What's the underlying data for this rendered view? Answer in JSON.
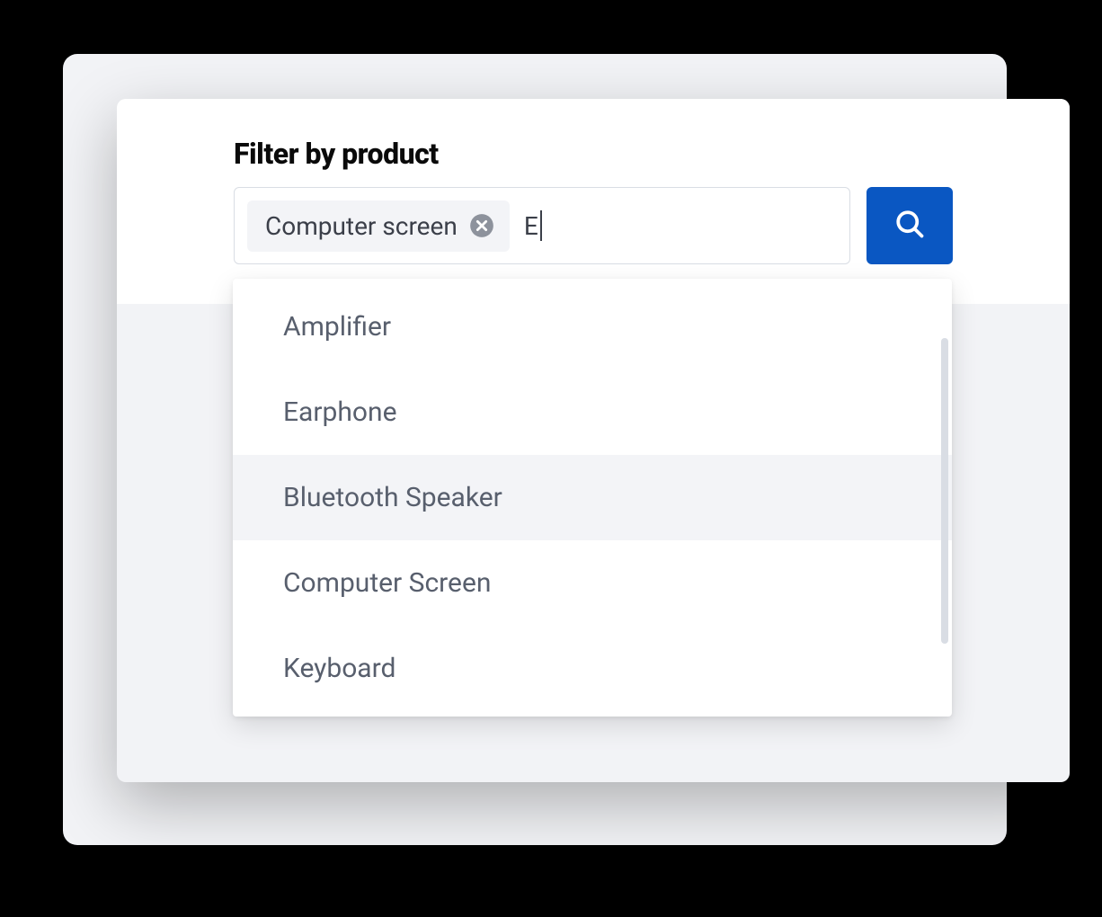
{
  "filter": {
    "title": "Filter by product",
    "chip_label": "Computer screen",
    "typed_value": "E",
    "search_button_icon": "search-icon",
    "chip_close_icon": "close-circle-icon"
  },
  "dropdown": {
    "items": [
      {
        "label": "Amplifier",
        "highlighted": false
      },
      {
        "label": "Earphone",
        "highlighted": false
      },
      {
        "label": "Bluetooth Speaker",
        "highlighted": true
      },
      {
        "label": "Computer Screen",
        "highlighted": false
      },
      {
        "label": "Keyboard",
        "highlighted": false
      }
    ]
  },
  "colors": {
    "accent": "#0a57c2",
    "panel": "#f2f3f6",
    "text": "#3b3f49"
  }
}
